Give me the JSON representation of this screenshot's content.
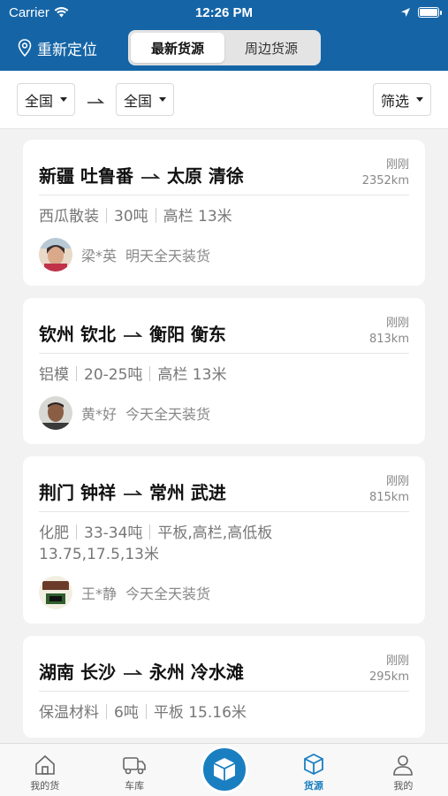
{
  "status": {
    "carrier": "Carrier",
    "time": "12:26 PM",
    "battery_level": 1.0
  },
  "header": {
    "relocate_label": "重新定位",
    "tabs": [
      {
        "label": "最新货源",
        "active": true
      },
      {
        "label": "周边货源",
        "active": false
      }
    ]
  },
  "filter": {
    "origin": "全国",
    "destination": "全国",
    "filter_label": "筛选"
  },
  "cards": [
    {
      "from": "新疆 吐鲁番",
      "to": "太原 清徐",
      "time": "刚刚",
      "distance": "2352km",
      "specs": [
        "西瓜散装",
        "30吨",
        "高栏 13米"
      ],
      "name": "梁*英",
      "load_time": "明天全天装货",
      "avatar": "woman"
    },
    {
      "from": "钦州 钦北",
      "to": "衡阳 衡东",
      "time": "刚刚",
      "distance": "813km",
      "specs": [
        "铝模",
        "20-25吨",
        "高栏 13米"
      ],
      "name": "黄*好",
      "load_time": "今天全天装货",
      "avatar": "man"
    },
    {
      "from": "荆门 钟祥",
      "to": "常州 武进",
      "time": "刚刚",
      "distance": "815km",
      "specs": [
        "化肥",
        "33-34吨",
        "平板,高栏,高低板"
      ],
      "specs_extra": "13.75,17.5,13米",
      "name": "王*静",
      "load_time": "今天全天装货",
      "avatar": "logo"
    },
    {
      "from": "湖南 长沙",
      "to": "永州 冷水滩",
      "time": "刚刚",
      "distance": "295km",
      "specs": [
        "保温材料",
        "6吨",
        "平板 15.16米"
      ],
      "name": "",
      "load_time": "",
      "avatar": ""
    }
  ],
  "tabbar": [
    {
      "label": "我的货",
      "icon": "home-icon",
      "active": false
    },
    {
      "label": "车库",
      "icon": "truck-icon",
      "active": false
    },
    {
      "label": "",
      "icon": "box-icon",
      "active": false
    },
    {
      "label": "货源",
      "icon": "cube-icon",
      "active": true
    },
    {
      "label": "我的",
      "icon": "person-icon",
      "active": false
    }
  ],
  "colors": {
    "brand": "#1565a6",
    "accent": "#1a7fc1"
  }
}
